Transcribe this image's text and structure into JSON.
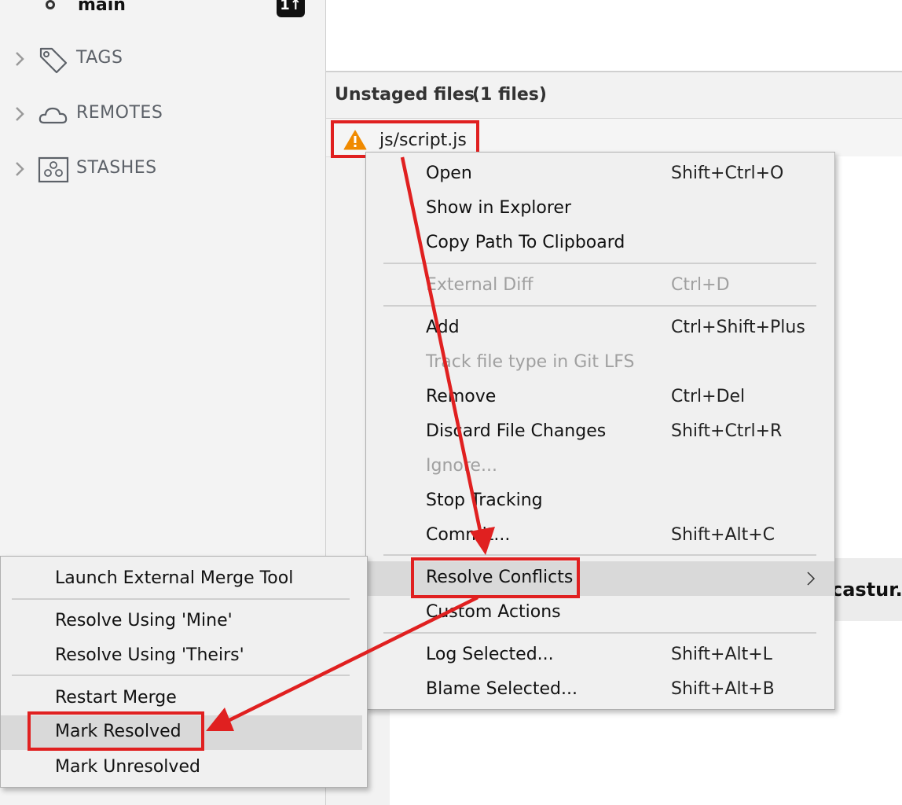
{
  "sidebar": {
    "branch": {
      "name": "main",
      "badge": "1↑"
    },
    "sections": [
      {
        "label": "TAGS",
        "icon": "tag-icon"
      },
      {
        "label": "REMOTES",
        "icon": "cloud-icon"
      },
      {
        "label": "STASHES",
        "icon": "stash-icon"
      }
    ]
  },
  "main": {
    "unstaged_title": "Unstaged files",
    "unstaged_count": "(1 files)",
    "file": {
      "name": "js/script.js",
      "status_icon": "warning-icon"
    },
    "partial_text": "castur.c"
  },
  "context_menu": {
    "items": [
      {
        "label": "Open",
        "shortcut": "Shift+Ctrl+O",
        "enabled": true
      },
      {
        "label": "Show in Explorer",
        "shortcut": "",
        "enabled": true
      },
      {
        "label": "Copy Path To Clipboard",
        "shortcut": "",
        "enabled": true
      },
      {
        "label": "External Diff",
        "shortcut": "Ctrl+D",
        "enabled": false
      },
      {
        "label": "Add",
        "shortcut": "Ctrl+Shift+Plus",
        "enabled": true
      },
      {
        "label": "Track file type in Git LFS",
        "shortcut": "",
        "enabled": false
      },
      {
        "label": "Remove",
        "shortcut": "Ctrl+Del",
        "enabled": true
      },
      {
        "label": "Discard File Changes",
        "shortcut": "Shift+Ctrl+R",
        "enabled": true
      },
      {
        "label": "Ignore...",
        "shortcut": "",
        "enabled": false
      },
      {
        "label": "Stop Tracking",
        "shortcut": "",
        "enabled": true
      },
      {
        "label": "Commit...",
        "shortcut": "Shift+Alt+C",
        "enabled": true
      },
      {
        "label": "Resolve Conflicts",
        "shortcut": "",
        "enabled": true,
        "submenu": true
      },
      {
        "label": "Custom Actions",
        "shortcut": "",
        "enabled": true
      },
      {
        "label": "Log Selected...",
        "shortcut": "Shift+Alt+L",
        "enabled": true
      },
      {
        "label": "Blame Selected...",
        "shortcut": "Shift+Alt+B",
        "enabled": true
      }
    ]
  },
  "submenu": {
    "items": [
      {
        "label": "Launch External Merge Tool"
      },
      {
        "label": "Resolve Using 'Mine'"
      },
      {
        "label": "Resolve Using 'Theirs'"
      },
      {
        "label": "Restart Merge"
      },
      {
        "label": "Mark Resolved"
      },
      {
        "label": "Mark Unresolved"
      }
    ]
  },
  "colors": {
    "annotation_red": "#e02020",
    "warning_orange": "#f08a00",
    "highlight": "#d9d9d9",
    "menu_bg": "#f0f0f0"
  }
}
